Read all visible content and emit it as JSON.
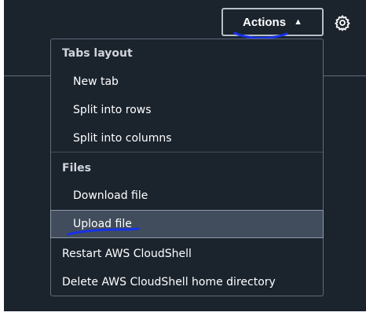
{
  "toolbar": {
    "actions_label": "Actions",
    "actions_caret": "▲"
  },
  "menu": {
    "groups": [
      {
        "label": "Tabs layout",
        "items": [
          "New tab",
          "Split into rows",
          "Split into columns"
        ]
      },
      {
        "label": "Files",
        "items": [
          "Download file",
          "Upload file"
        ]
      }
    ],
    "standalone_items": [
      "Restart AWS CloudShell",
      "Delete AWS CloudShell home directory"
    ],
    "highlighted_item": "Upload file"
  },
  "colors": {
    "background": "#1b232d",
    "menu_border": "#5f6b7a",
    "highlight": "#414d5c",
    "text": "#ffffff",
    "annotation_ink": "#1732e6"
  },
  "icons": {
    "settings": "gear-icon",
    "caret": "caret-up-icon"
  }
}
